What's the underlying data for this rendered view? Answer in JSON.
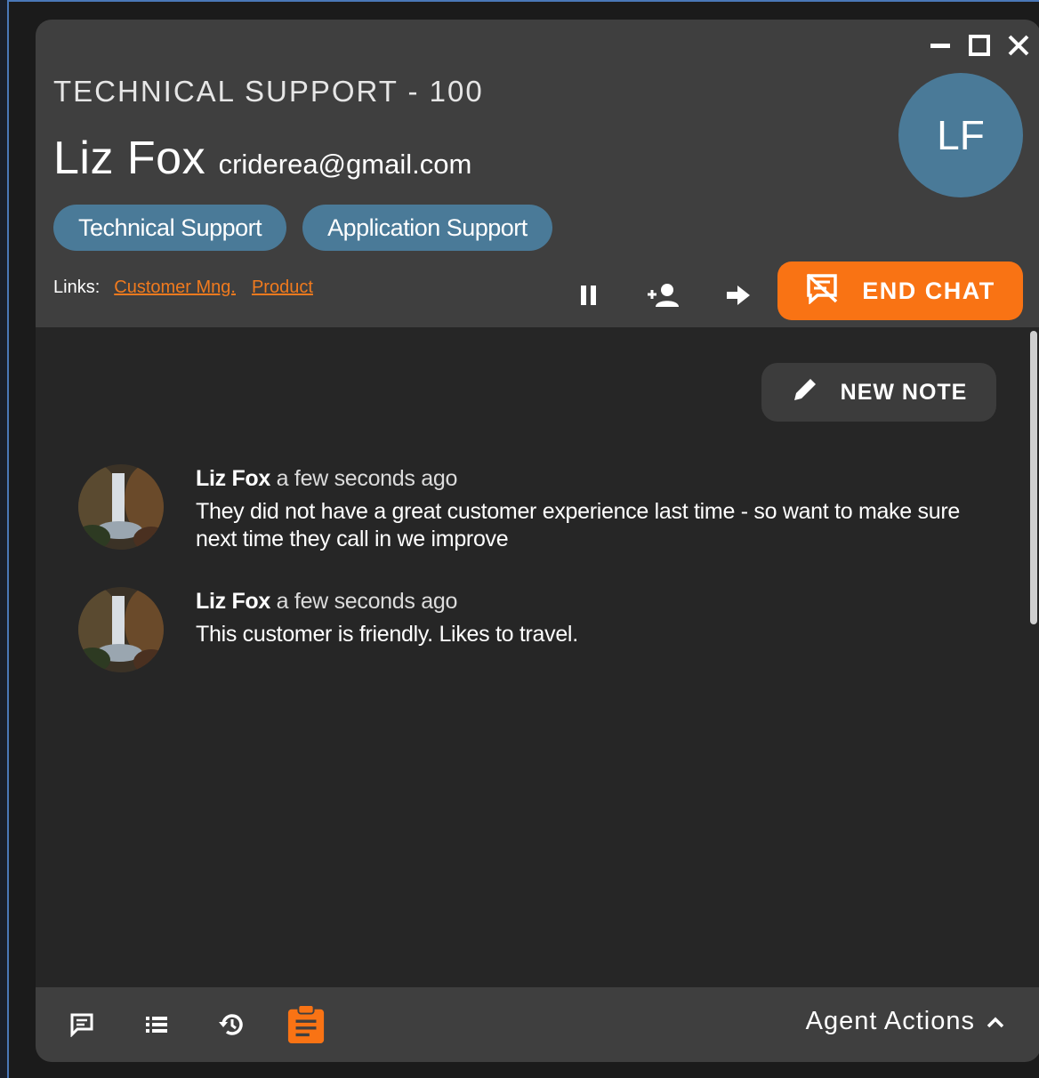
{
  "header": {
    "queue_title": "TECHNICAL SUPPORT - 100",
    "customer_name": "Liz Fox",
    "customer_email": "criderea@gmail.com",
    "avatar_initials": "LF",
    "tags": [
      "Technical Support",
      "Application Support"
    ],
    "links_label": "Links:",
    "links": [
      "Customer Mng.",
      "Product"
    ],
    "end_chat_label": "END CHAT",
    "window_controls": [
      "minimize-icon",
      "maximize-icon",
      "close-icon"
    ],
    "action_icons": [
      "pause-icon",
      "add-user-icon",
      "transfer-arrow-icon"
    ]
  },
  "notes_panel": {
    "new_note_label": "NEW NOTE",
    "notes": [
      {
        "author": "Liz Fox",
        "time": "a few seconds ago",
        "text": "They did not have a great customer experience last time - so want to make sure next time they call in we improve"
      },
      {
        "author": "Liz Fox",
        "time": "a few seconds ago",
        "text": "This customer is friendly. Likes to travel."
      }
    ]
  },
  "footer": {
    "icons": [
      "chat-icon",
      "list-icon",
      "history-icon",
      "notes-clipboard-icon"
    ],
    "active_icon": "notes-clipboard-icon",
    "agent_actions_label": "Agent Actions"
  },
  "colors": {
    "accent_orange": "#f97314",
    "tag_blue": "#4a7a98",
    "header_bg": "#3f3f3f",
    "body_bg": "#262626"
  }
}
